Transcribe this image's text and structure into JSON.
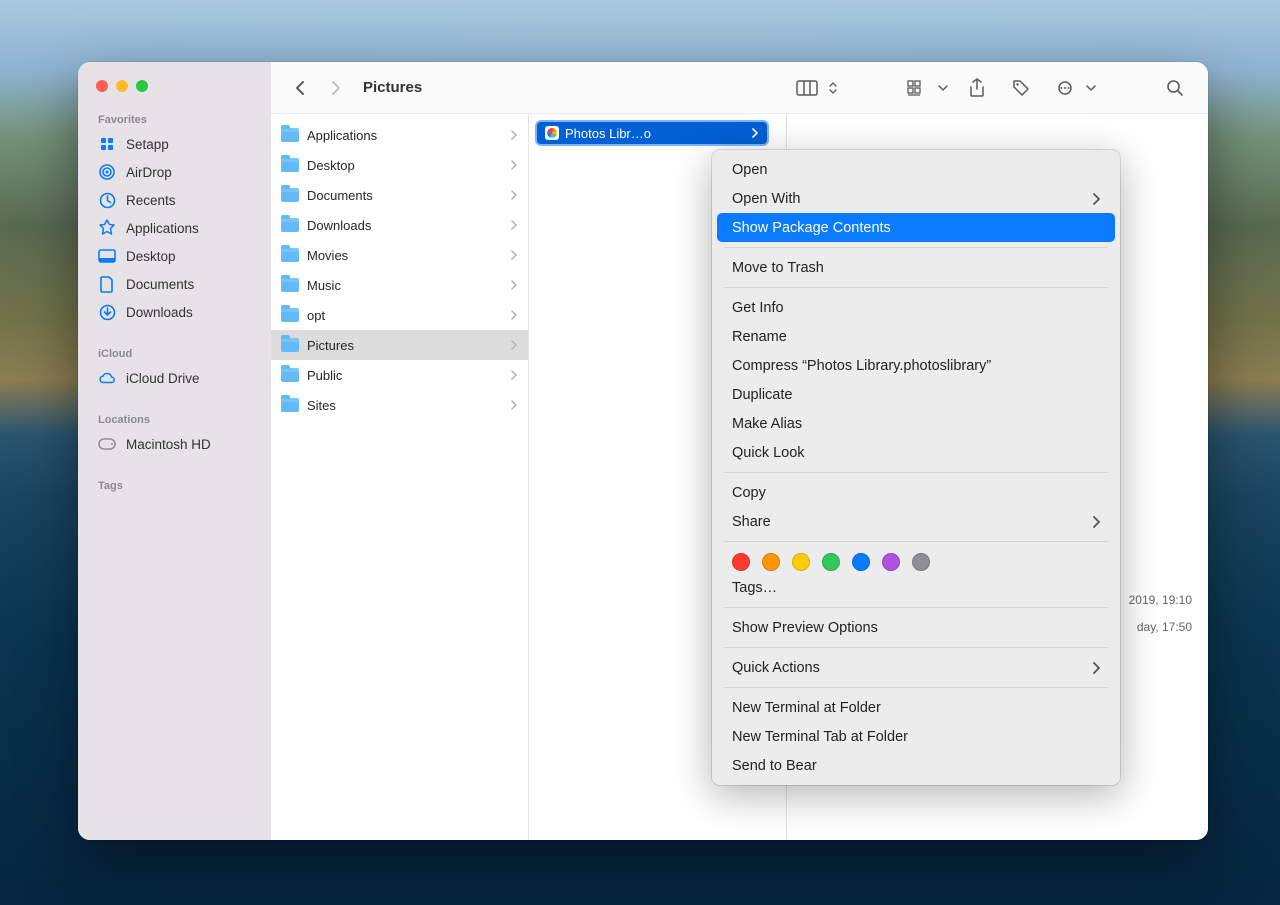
{
  "window": {
    "title": "Pictures"
  },
  "sidebar": {
    "sections": [
      {
        "label": "Favorites",
        "items": [
          {
            "label": "Setapp",
            "icon": "setapp"
          },
          {
            "label": "AirDrop",
            "icon": "airdrop"
          },
          {
            "label": "Recents",
            "icon": "recents"
          },
          {
            "label": "Applications",
            "icon": "apps"
          },
          {
            "label": "Desktop",
            "icon": "desktop"
          },
          {
            "label": "Documents",
            "icon": "documents"
          },
          {
            "label": "Downloads",
            "icon": "downloads"
          }
        ]
      },
      {
        "label": "iCloud",
        "items": [
          {
            "label": "iCloud Drive",
            "icon": "cloud"
          }
        ]
      },
      {
        "label": "Locations",
        "items": [
          {
            "label": "Macintosh HD",
            "icon": "disk"
          }
        ]
      },
      {
        "label": "Tags",
        "items": []
      }
    ]
  },
  "column1": {
    "items": [
      {
        "label": "Applications",
        "has_children": true
      },
      {
        "label": "Desktop",
        "has_children": true
      },
      {
        "label": "Documents",
        "has_children": true
      },
      {
        "label": "Downloads",
        "has_children": true
      },
      {
        "label": "Movies",
        "has_children": true
      },
      {
        "label": "Music",
        "has_children": true
      },
      {
        "label": "opt",
        "has_children": true
      },
      {
        "label": "Pictures",
        "has_children": true,
        "selected": true
      },
      {
        "label": "Public",
        "has_children": true
      },
      {
        "label": "Sites",
        "has_children": true
      }
    ]
  },
  "column2": {
    "selected_item": "Photos Libr…o",
    "selected_item_full": "Photos Library.photoslibrary"
  },
  "preview": {
    "date1": "2019, 19:10",
    "date2": "day, 17:50"
  },
  "context_menu": {
    "items": [
      {
        "label": "Open"
      },
      {
        "label": "Open With",
        "submenu": true
      },
      {
        "label": "Show Package Contents",
        "highlight": true
      },
      {
        "sep": true
      },
      {
        "label": "Move to Trash"
      },
      {
        "sep": true
      },
      {
        "label": "Get Info"
      },
      {
        "label": "Rename"
      },
      {
        "label": "Compress “Photos Library.photoslibrary”"
      },
      {
        "label": "Duplicate"
      },
      {
        "label": "Make Alias"
      },
      {
        "label": "Quick Look"
      },
      {
        "sep": true
      },
      {
        "label": "Copy"
      },
      {
        "label": "Share",
        "submenu": true
      },
      {
        "sep": true
      },
      {
        "tags": true
      },
      {
        "label": "Tags…"
      },
      {
        "sep": true
      },
      {
        "label": "Show Preview Options"
      },
      {
        "sep": true
      },
      {
        "label": "Quick Actions",
        "submenu": true
      },
      {
        "sep": true
      },
      {
        "label": "New Terminal at Folder"
      },
      {
        "label": "New Terminal Tab at Folder"
      },
      {
        "label": "Send to Bear"
      }
    ],
    "tag_colors": [
      "#ff3b30",
      "#ff9500",
      "#ffcc00",
      "#34c759",
      "#0a7aff",
      "#af52de",
      "#8e8e93"
    ]
  }
}
